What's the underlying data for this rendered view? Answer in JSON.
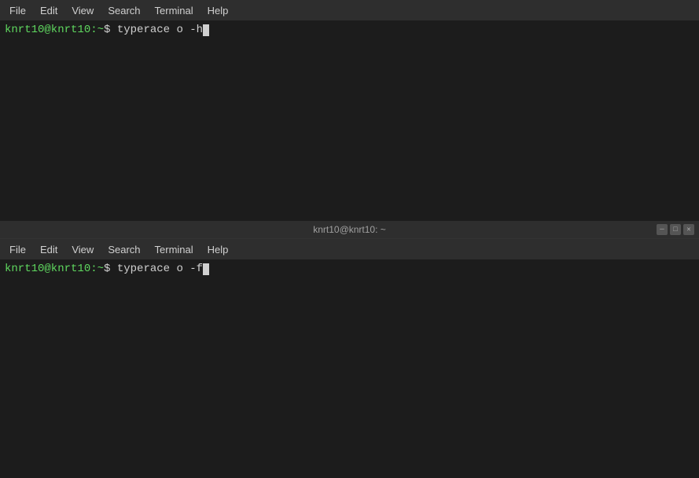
{
  "top_pane": {
    "menubar": {
      "items": [
        "File",
        "Edit",
        "View",
        "Search",
        "Terminal",
        "Help"
      ]
    },
    "prompt": {
      "user": "knrt10@knrt10:~",
      "dollar": "$",
      "command": " typerace o -h"
    },
    "status_bar": {
      "title": "knrt10@knrt10: ~"
    },
    "window_controls": [
      "─",
      "□",
      "✕"
    ]
  },
  "bottom_pane": {
    "menubar": {
      "items": [
        "File",
        "Edit",
        "View",
        "Search",
        "Terminal",
        "Help"
      ]
    },
    "prompt": {
      "user": "knrt10@knrt10:~",
      "dollar": "$",
      "command": " typerace o -f"
    }
  }
}
